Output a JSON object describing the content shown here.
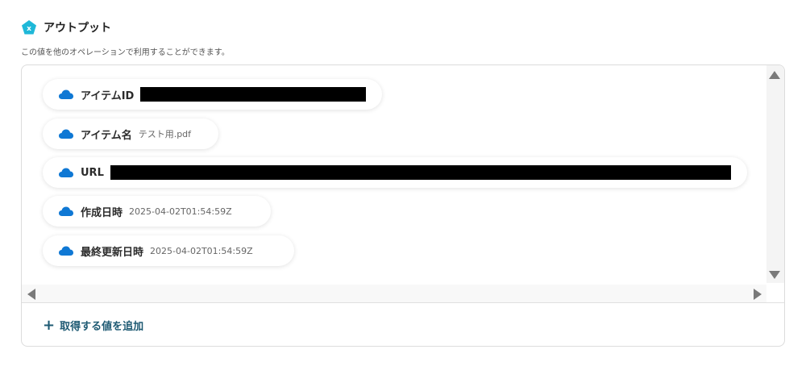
{
  "header": {
    "icon": "pentagon-x-icon",
    "title": "アウトプット",
    "description": "この値を他のオペレーションで利用することができます。"
  },
  "outputs": [
    {
      "icon": "onedrive-cloud-icon",
      "label": "アイテムID",
      "value": "",
      "redacted": true
    },
    {
      "icon": "onedrive-cloud-icon",
      "label": "アイテム名",
      "value": "テスト用.pdf",
      "redacted": false
    },
    {
      "icon": "onedrive-cloud-icon",
      "label": "URL",
      "value": "",
      "redacted": true
    },
    {
      "icon": "onedrive-cloud-icon",
      "label": "作成日時",
      "value": "2025-04-02T01:54:59Z",
      "redacted": false
    },
    {
      "icon": "onedrive-cloud-icon",
      "label": "最終更新日時",
      "value": "2025-04-02T01:54:59Z",
      "redacted": false
    }
  ],
  "add_button": {
    "icon": "plus-icon",
    "label": "取得する値を追加"
  },
  "colors": {
    "accent": "#1e5a73",
    "header_icon": "#1fb8d8",
    "cloud": "#0f78d4"
  }
}
